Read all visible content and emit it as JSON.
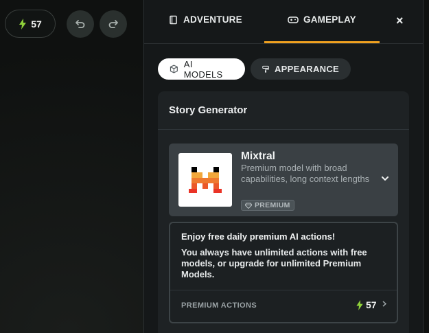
{
  "topbar": {
    "energy_count": "57",
    "undo_icon": "undo-icon",
    "redo_icon": "redo-icon",
    "bolt_color": "#8fd13a"
  },
  "panel": {
    "tabs": [
      {
        "label": "ADVENTURE",
        "icon": "book-icon",
        "active": false
      },
      {
        "label": "GAMEPLAY",
        "icon": "gamepad-icon",
        "active": true
      }
    ],
    "accent_color": "#f0a11f",
    "close_glyph": "×",
    "subtabs": [
      {
        "label": "AI MODELS",
        "icon": "cube-icon",
        "active": true
      },
      {
        "label": "APPEARANCE",
        "icon": "paint-roller-icon",
        "active": false
      }
    ],
    "section_title": "Story Generator",
    "model": {
      "name": "Mixtral",
      "description": "Premium model with broad capabilities, long context lengths",
      "badge": "PREMIUM",
      "badge_icon": "gem-icon"
    },
    "promo": {
      "title": "Enjoy free daily premium AI actions!",
      "body": "You always have unlimited actions with free models, or upgrade for unlimited Premium Models.",
      "footer_label": "PREMIUM ACTIONS",
      "footer_value": "57"
    }
  }
}
